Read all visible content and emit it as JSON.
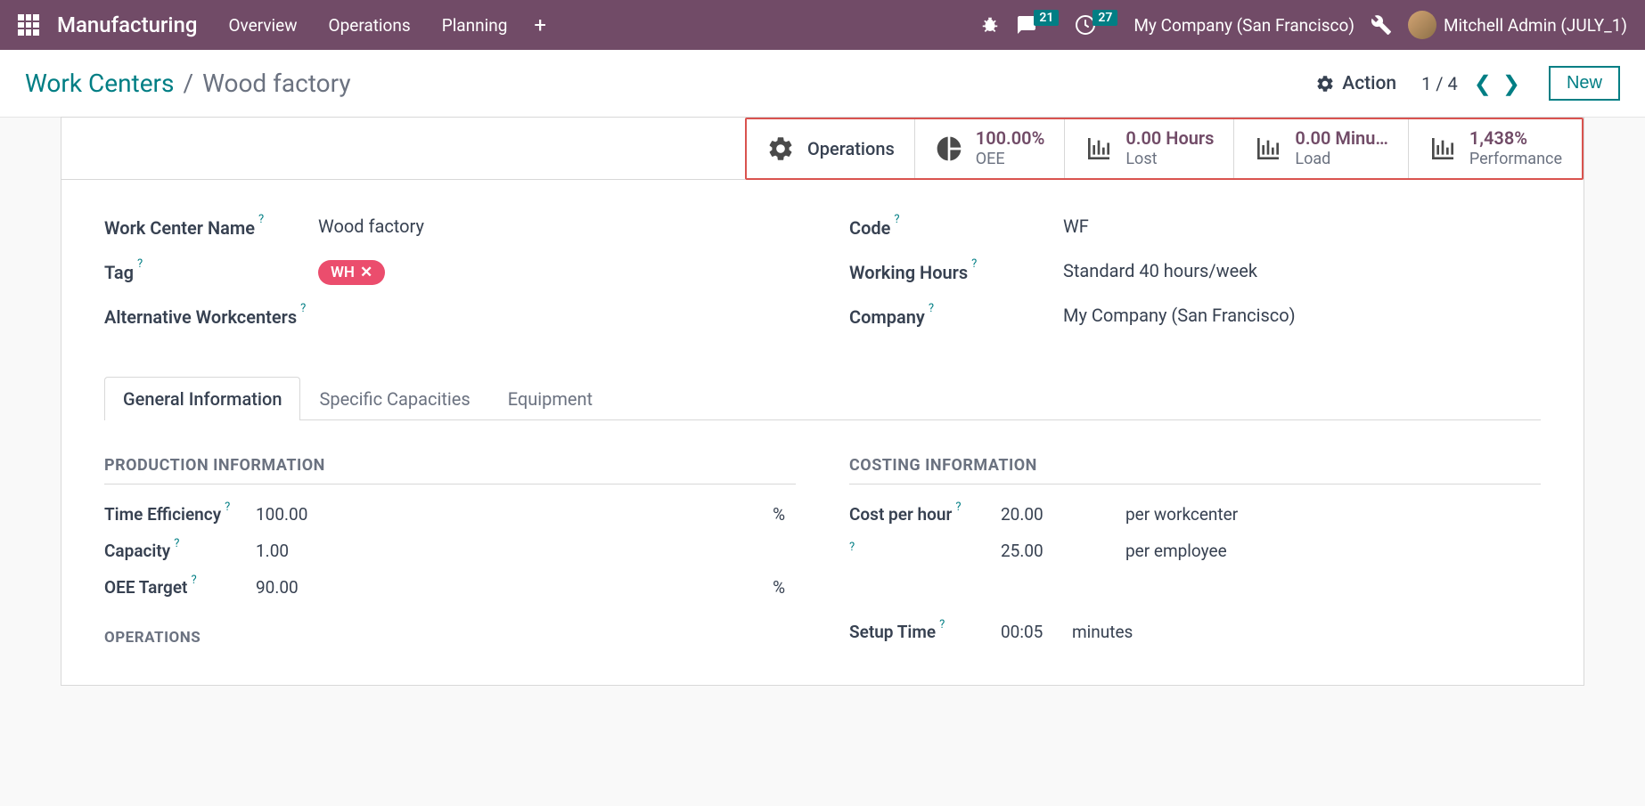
{
  "navbar": {
    "brand": "Manufacturing",
    "items": [
      "Overview",
      "Operations",
      "Planning"
    ],
    "messages_badge": "21",
    "activities_badge": "27",
    "company": "My Company (San Francisco)",
    "user": "Mitchell Admin (JULY_1)"
  },
  "breadcrumb": {
    "parent": "Work Centers",
    "current": "Wood factory",
    "action_label": "Action",
    "pager": "1 / 4",
    "new_label": "New"
  },
  "stats": {
    "operations": {
      "label": "Operations"
    },
    "oee": {
      "value": "100.00%",
      "label": "OEE"
    },
    "lost": {
      "value": "0.00 Hours",
      "label": "Lost"
    },
    "load": {
      "value": "0.00 Minu…",
      "label": "Load"
    },
    "performance": {
      "value": "1,438%",
      "label": "Performance"
    }
  },
  "fields": {
    "name_label": "Work Center Name",
    "name_value": "Wood factory",
    "tag_label": "Tag",
    "tag_value": "WH",
    "alt_label": "Alternative Workcenters",
    "code_label": "Code",
    "code_value": "WF",
    "hours_label": "Working Hours",
    "hours_value": "Standard 40 hours/week",
    "company_label": "Company",
    "company_value": "My Company (San Francisco)"
  },
  "tabs": {
    "general": "General Information",
    "specific": "Specific Capacities",
    "equipment": "Equipment"
  },
  "production": {
    "title": "PRODUCTION INFORMATION",
    "time_eff_label": "Time Efficiency",
    "time_eff_value": "100.00",
    "capacity_label": "Capacity",
    "capacity_value": "1.00",
    "oee_target_label": "OEE Target",
    "oee_target_value": "90.00",
    "pct": "%",
    "operations_title": "OPERATIONS"
  },
  "costing": {
    "title": "COSTING INFORMATION",
    "cph_label": "Cost per hour",
    "cph_value": "20.00",
    "cph_unit": "per workcenter",
    "cpe_value": "25.00",
    "cpe_unit": "per employee",
    "setup_label": "Setup Time",
    "setup_value": "00:05",
    "setup_unit": "minutes"
  }
}
